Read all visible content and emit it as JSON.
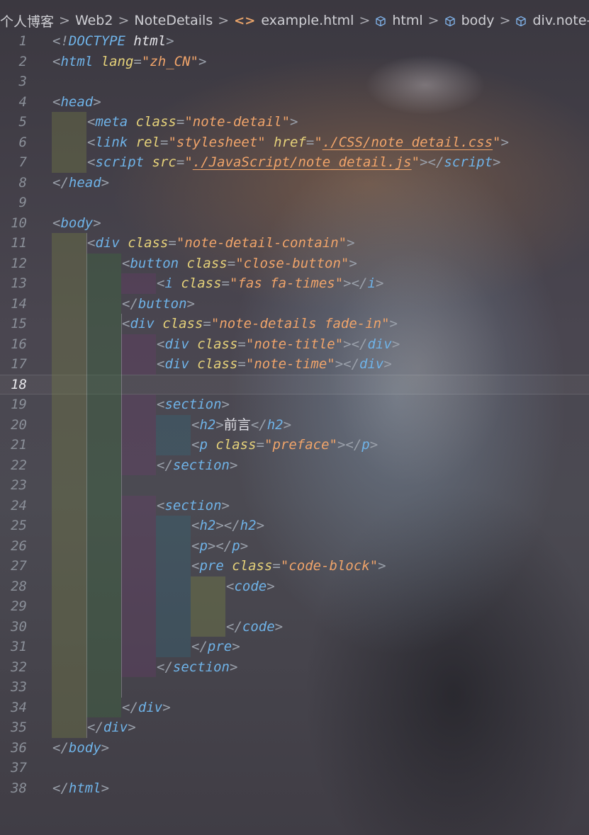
{
  "breadcrumb": {
    "items": [
      {
        "label": "个人博客",
        "icon": ""
      },
      {
        "label": "Web2",
        "icon": ""
      },
      {
        "label": "NoteDetails",
        "icon": ""
      },
      {
        "label": "example.html",
        "icon": "html-file-icon"
      },
      {
        "label": "html",
        "icon": "cube-icon"
      },
      {
        "label": "body",
        "icon": "cube-icon"
      },
      {
        "label": "div.note-detail-co",
        "icon": "cube-icon"
      }
    ],
    "separator": ">"
  },
  "editor": {
    "current_line": 18,
    "lines": [
      {
        "n": "1",
        "indent": 0,
        "tokens": [
          [
            "p",
            "<!"
          ],
          [
            "t",
            "DOCTYPE"
          ],
          [
            "kw",
            " html"
          ],
          [
            "p",
            ">"
          ]
        ]
      },
      {
        "n": "2",
        "indent": 0,
        "tokens": [
          [
            "p",
            "<"
          ],
          [
            "t",
            "html"
          ],
          [
            "a",
            " lang"
          ],
          [
            "p",
            "="
          ],
          [
            "s",
            "\"zh_CN\""
          ],
          [
            "p",
            ">"
          ]
        ]
      },
      {
        "n": "3",
        "indent": 0,
        "tokens": []
      },
      {
        "n": "4",
        "indent": 0,
        "tokens": [
          [
            "p",
            "<"
          ],
          [
            "t",
            "head"
          ],
          [
            "p",
            ">"
          ]
        ]
      },
      {
        "n": "5",
        "indent": 1,
        "tokens": [
          [
            "p",
            "<"
          ],
          [
            "t",
            "meta"
          ],
          [
            "a",
            " class"
          ],
          [
            "p",
            "="
          ],
          [
            "s",
            "\"note-detail\""
          ],
          [
            "p",
            ">"
          ]
        ]
      },
      {
        "n": "6",
        "indent": 1,
        "tokens": [
          [
            "p",
            "<"
          ],
          [
            "t",
            "link"
          ],
          [
            "a",
            " rel"
          ],
          [
            "p",
            "="
          ],
          [
            "s",
            "\"stylesheet\""
          ],
          [
            "a",
            " href"
          ],
          [
            "p",
            "="
          ],
          [
            "s",
            "\""
          ],
          [
            "u",
            "./CSS/note_detail.css"
          ],
          [
            "s",
            "\""
          ],
          [
            "p",
            ">"
          ]
        ]
      },
      {
        "n": "7",
        "indent": 1,
        "tokens": [
          [
            "p",
            "<"
          ],
          [
            "t",
            "script"
          ],
          [
            "a",
            " src"
          ],
          [
            "p",
            "="
          ],
          [
            "s",
            "\""
          ],
          [
            "u",
            "./JavaScript/note_detail.js"
          ],
          [
            "s",
            "\""
          ],
          [
            "p",
            "></"
          ],
          [
            "t",
            "script"
          ],
          [
            "p",
            ">"
          ]
        ]
      },
      {
        "n": "8",
        "indent": 0,
        "tokens": [
          [
            "p",
            "</"
          ],
          [
            "t",
            "head"
          ],
          [
            "p",
            ">"
          ]
        ]
      },
      {
        "n": "9",
        "indent": 0,
        "tokens": []
      },
      {
        "n": "10",
        "indent": 0,
        "tokens": [
          [
            "p",
            "<"
          ],
          [
            "t",
            "body"
          ],
          [
            "p",
            ">"
          ]
        ]
      },
      {
        "n": "11",
        "indent": 1,
        "tokens": [
          [
            "p",
            "<"
          ],
          [
            "t",
            "div"
          ],
          [
            "a",
            " class"
          ],
          [
            "p",
            "="
          ],
          [
            "s",
            "\"note-detail-contain\""
          ],
          [
            "p",
            ">"
          ]
        ]
      },
      {
        "n": "12",
        "indent": 2,
        "tokens": [
          [
            "p",
            "<"
          ],
          [
            "t",
            "button"
          ],
          [
            "a",
            " class"
          ],
          [
            "p",
            "="
          ],
          [
            "s",
            "\"close-button\""
          ],
          [
            "p",
            ">"
          ]
        ]
      },
      {
        "n": "13",
        "indent": 3,
        "tokens": [
          [
            "p",
            "<"
          ],
          [
            "t",
            "i"
          ],
          [
            "a",
            " class"
          ],
          [
            "p",
            "="
          ],
          [
            "s",
            "\"fas fa-times\""
          ],
          [
            "p",
            "></"
          ],
          [
            "t",
            "i"
          ],
          [
            "p",
            ">"
          ]
        ]
      },
      {
        "n": "14",
        "indent": 2,
        "tokens": [
          [
            "p",
            "</"
          ],
          [
            "t",
            "button"
          ],
          [
            "p",
            ">"
          ]
        ]
      },
      {
        "n": "15",
        "indent": 2,
        "tokens": [
          [
            "p",
            "<"
          ],
          [
            "t",
            "div"
          ],
          [
            "a",
            " class"
          ],
          [
            "p",
            "="
          ],
          [
            "s",
            "\"note-details fade-in\""
          ],
          [
            "p",
            ">"
          ]
        ]
      },
      {
        "n": "16",
        "indent": 3,
        "tokens": [
          [
            "p",
            "<"
          ],
          [
            "t",
            "div"
          ],
          [
            "a",
            " class"
          ],
          [
            "p",
            "="
          ],
          [
            "s",
            "\"note-title\""
          ],
          [
            "p",
            "></"
          ],
          [
            "t",
            "div"
          ],
          [
            "p",
            ">"
          ]
        ]
      },
      {
        "n": "17",
        "indent": 3,
        "tokens": [
          [
            "p",
            "<"
          ],
          [
            "t",
            "div"
          ],
          [
            "a",
            " class"
          ],
          [
            "p",
            "="
          ],
          [
            "s",
            "\"note-time\""
          ],
          [
            "p",
            "></"
          ],
          [
            "t",
            "div"
          ],
          [
            "p",
            ">"
          ]
        ]
      },
      {
        "n": "18",
        "indent": 0,
        "tokens": []
      },
      {
        "n": "19",
        "indent": 3,
        "tokens": [
          [
            "p",
            "<"
          ],
          [
            "t",
            "section"
          ],
          [
            "p",
            ">"
          ]
        ]
      },
      {
        "n": "20",
        "indent": 4,
        "tokens": [
          [
            "p",
            "<"
          ],
          [
            "t",
            "h2"
          ],
          [
            "p",
            ">"
          ],
          [
            "txt",
            "前言"
          ],
          [
            "p",
            "</"
          ],
          [
            "t",
            "h2"
          ],
          [
            "p",
            ">"
          ]
        ]
      },
      {
        "n": "21",
        "indent": 4,
        "tokens": [
          [
            "p",
            "<"
          ],
          [
            "t",
            "p"
          ],
          [
            "a",
            " class"
          ],
          [
            "p",
            "="
          ],
          [
            "s",
            "\"preface\""
          ],
          [
            "p",
            "></"
          ],
          [
            "t",
            "p"
          ],
          [
            "p",
            ">"
          ]
        ]
      },
      {
        "n": "22",
        "indent": 3,
        "tokens": [
          [
            "p",
            "</"
          ],
          [
            "t",
            "section"
          ],
          [
            "p",
            ">"
          ]
        ]
      },
      {
        "n": "23",
        "indent": 0,
        "tokens": []
      },
      {
        "n": "24",
        "indent": 3,
        "tokens": [
          [
            "p",
            "<"
          ],
          [
            "t",
            "section"
          ],
          [
            "p",
            ">"
          ]
        ]
      },
      {
        "n": "25",
        "indent": 4,
        "tokens": [
          [
            "p",
            "<"
          ],
          [
            "t",
            "h2"
          ],
          [
            "p",
            "></"
          ],
          [
            "t",
            "h2"
          ],
          [
            "p",
            ">"
          ]
        ]
      },
      {
        "n": "26",
        "indent": 4,
        "tokens": [
          [
            "p",
            "<"
          ],
          [
            "t",
            "p"
          ],
          [
            "p",
            "></"
          ],
          [
            "t",
            "p"
          ],
          [
            "p",
            ">"
          ]
        ]
      },
      {
        "n": "27",
        "indent": 4,
        "tokens": [
          [
            "p",
            "<"
          ],
          [
            "t",
            "pre"
          ],
          [
            "a",
            " class"
          ],
          [
            "p",
            "="
          ],
          [
            "s",
            "\"code-block\""
          ],
          [
            "p",
            ">"
          ]
        ]
      },
      {
        "n": "28",
        "indent": 5,
        "tokens": [
          [
            "p",
            "<"
          ],
          [
            "t",
            "code"
          ],
          [
            "p",
            ">"
          ]
        ]
      },
      {
        "n": "29",
        "indent": 0,
        "tokens": []
      },
      {
        "n": "30",
        "indent": 5,
        "tokens": [
          [
            "p",
            "</"
          ],
          [
            "t",
            "code"
          ],
          [
            "p",
            ">"
          ]
        ]
      },
      {
        "n": "31",
        "indent": 4,
        "tokens": [
          [
            "p",
            "</"
          ],
          [
            "t",
            "pre"
          ],
          [
            "p",
            ">"
          ]
        ]
      },
      {
        "n": "32",
        "indent": 3,
        "tokens": [
          [
            "p",
            "</"
          ],
          [
            "t",
            "section"
          ],
          [
            "p",
            ">"
          ]
        ]
      },
      {
        "n": "33",
        "indent": 0,
        "tokens": []
      },
      {
        "n": "34",
        "indent": 2,
        "tokens": [
          [
            "p",
            "</"
          ],
          [
            "t",
            "div"
          ],
          [
            "p",
            ">"
          ]
        ]
      },
      {
        "n": "35",
        "indent": 1,
        "tokens": [
          [
            "p",
            "</"
          ],
          [
            "t",
            "div"
          ],
          [
            "p",
            ">"
          ]
        ]
      },
      {
        "n": "36",
        "indent": 0,
        "tokens": [
          [
            "p",
            "</"
          ],
          [
            "t",
            "body"
          ],
          [
            "p",
            ">"
          ]
        ]
      },
      {
        "n": "37",
        "indent": 0,
        "tokens": []
      },
      {
        "n": "38",
        "indent": 0,
        "tokens": [
          [
            "p",
            "</"
          ],
          [
            "t",
            "html"
          ],
          [
            "p",
            ">"
          ]
        ]
      }
    ]
  }
}
